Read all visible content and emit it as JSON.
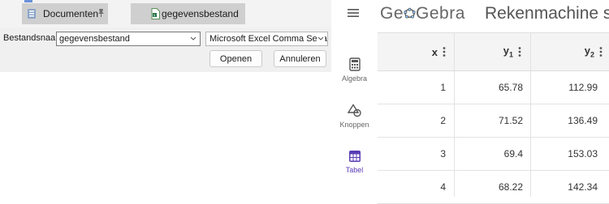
{
  "dialog": {
    "tiles": [
      {
        "label": "Documenten",
        "icon": "documents-icon",
        "pin_icon": "pin-icon"
      },
      {
        "label": "gegevensbestand",
        "icon": "excel-file-icon"
      }
    ],
    "filename_label": "Bestandsnaam:",
    "filename_value": "gegevensbestand",
    "filetype_value": "Microsoft Excel Comma Separa",
    "open_label": "Openen",
    "cancel_label": "Annuleren"
  },
  "geogebra": {
    "menu_icon": "hamburger-menu-icon",
    "logo": {
      "before": "Ge",
      "after": "Gebra"
    },
    "app_title": "Rekenmachine su",
    "nav": [
      {
        "label": "Algebra",
        "icon": "calculator-icon"
      },
      {
        "label": "Knoppen",
        "icon": "shapes-icon"
      },
      {
        "label": "Tabel",
        "icon": "table-icon",
        "active": true
      }
    ],
    "accent_color": "#5a3db5",
    "table": {
      "headers": [
        {
          "name": "x",
          "sub": ""
        },
        {
          "name": "y",
          "sub": "1"
        },
        {
          "name": "y",
          "sub": "2"
        }
      ],
      "rows": [
        [
          "1",
          "65.78",
          "112.99"
        ],
        [
          "2",
          "71.52",
          "136.49"
        ],
        [
          "3",
          "69.4",
          "153.03"
        ],
        [
          "4",
          "68.22",
          "142.34"
        ]
      ]
    }
  }
}
